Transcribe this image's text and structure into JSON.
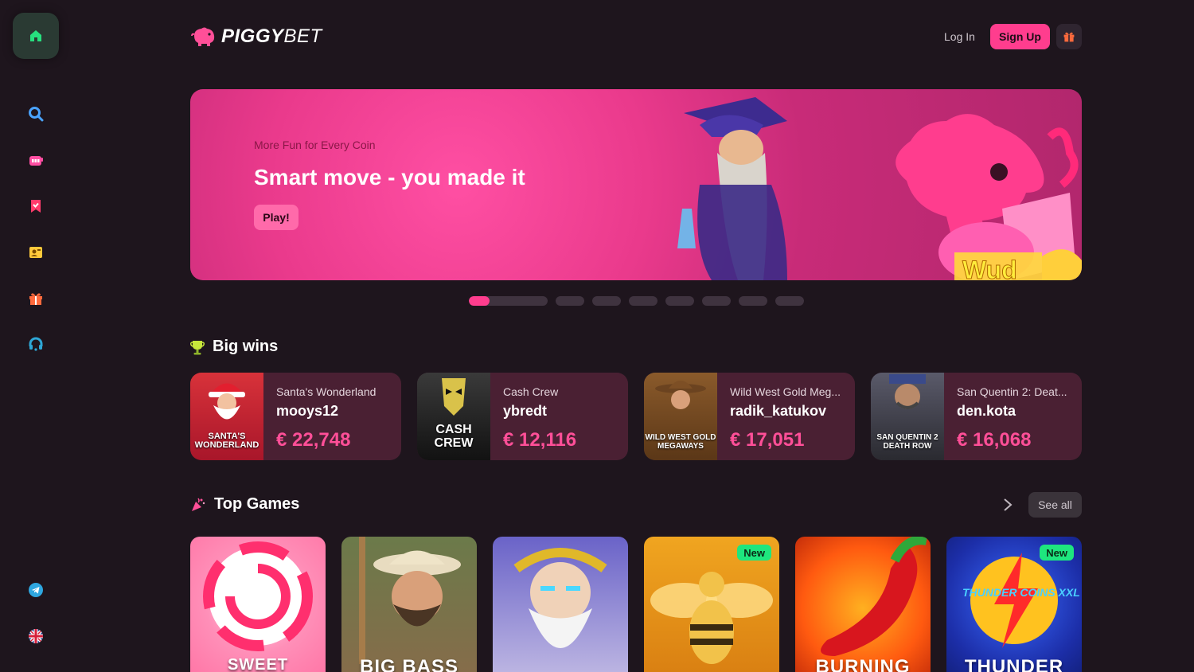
{
  "brand": {
    "name_main": "PIGGY",
    "name_suffix": "BET"
  },
  "header": {
    "login_label": "Log In",
    "signup_label": "Sign Up"
  },
  "sidebar": {
    "items": [
      {
        "icon": "home-icon"
      },
      {
        "icon": "search-icon"
      },
      {
        "icon": "slots-icon"
      },
      {
        "icon": "bookmark-icon"
      },
      {
        "icon": "live-casino-icon"
      },
      {
        "icon": "gift-icon"
      },
      {
        "icon": "support-icon"
      },
      {
        "icon": "telegram-icon"
      },
      {
        "icon": "uk-flag-icon"
      }
    ]
  },
  "banner": {
    "subtitle": "More Fun for Every Coin",
    "title": "Smart move - you made it",
    "cta": "Play!",
    "slides": 9,
    "active_slide": 1
  },
  "big_wins": {
    "title": "Big wins",
    "items": [
      {
        "game": "Santa's Wonderland",
        "thumb_label": "SANTA'S WONDERLAND",
        "user": "mooys12",
        "amount": "€ 22,748"
      },
      {
        "game": "Cash Crew",
        "thumb_label": "CASH CREW",
        "user": "ybredt",
        "amount": "€ 12,116"
      },
      {
        "game": "Wild West Gold Meg...",
        "thumb_label": "WILD WEST GOLD MEGAWAYS",
        "user": "radik_katukov",
        "amount": "€ 17,051"
      },
      {
        "game": "San Quentin 2: Deat...",
        "thumb_label": "SAN QUENTIN 2 DEATH ROW",
        "user": "den.kota",
        "amount": "€ 16,068"
      }
    ]
  },
  "top_games": {
    "title": "Top Games",
    "see_all": "See all",
    "items": [
      {
        "name": "SWEET BONANZA",
        "badge": ""
      },
      {
        "name": "BIG BASS",
        "badge": ""
      },
      {
        "name": "",
        "badge": ""
      },
      {
        "name": "",
        "badge": "New"
      },
      {
        "name": "BURNING",
        "badge": ""
      },
      {
        "name": "THUNDER",
        "badge": "New"
      }
    ]
  },
  "colors": {
    "accent": "#ff3d8e",
    "background": "#1e151d",
    "card": "#4a2033",
    "new_badge": "#1ee67e"
  }
}
